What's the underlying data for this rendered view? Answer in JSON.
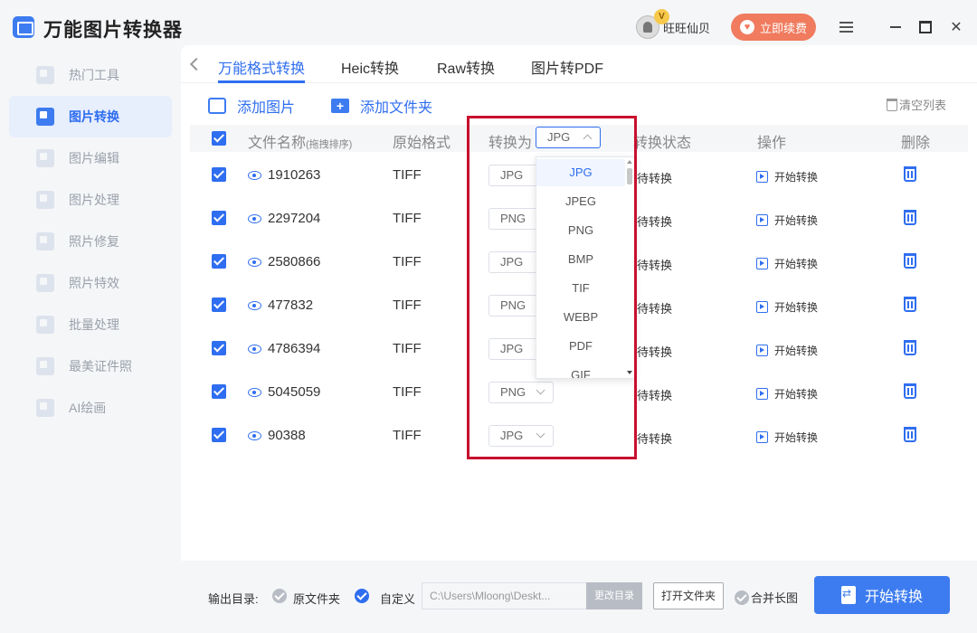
{
  "app": {
    "title": "万能图片转换器"
  },
  "user": {
    "name": "旺旺仙贝",
    "vip_badge": "V",
    "renew_label": "立即续费"
  },
  "sidebar": {
    "items": [
      {
        "label": "热门工具",
        "active": false
      },
      {
        "label": "图片转换",
        "active": true
      },
      {
        "label": "图片编辑",
        "active": false
      },
      {
        "label": "图片处理",
        "active": false
      },
      {
        "label": "照片修复",
        "active": false
      },
      {
        "label": "照片特效",
        "active": false
      },
      {
        "label": "批量处理",
        "active": false
      },
      {
        "label": "最美证件照",
        "active": false
      },
      {
        "label": "AI绘画",
        "active": false
      }
    ]
  },
  "tabs": [
    {
      "label": "万能格式转换",
      "active": true
    },
    {
      "label": "Heic转换",
      "active": false
    },
    {
      "label": "Raw转换",
      "active": false
    },
    {
      "label": "图片转PDF",
      "active": false
    }
  ],
  "toolbar": {
    "add_image": "添加图片",
    "add_folder": "添加文件夹",
    "clear_list": "清空列表"
  },
  "table": {
    "headers": {
      "filename": "文件名称",
      "filename_hint": "(拖拽排序)",
      "original_format": "原始格式",
      "convert_to": "转换为",
      "convert_to_value": "JPG",
      "status": "转换状态",
      "operation": "操作",
      "delete": "删除"
    },
    "rows": [
      {
        "name": "1910263",
        "orig": "TIFF",
        "target": "JPG",
        "status": "待转换",
        "op": "开始转换"
      },
      {
        "name": "2297204",
        "orig": "TIFF",
        "target": "PNG",
        "status": "待转换",
        "op": "开始转换"
      },
      {
        "name": "2580866",
        "orig": "TIFF",
        "target": "JPG",
        "status": "待转换",
        "op": "开始转换"
      },
      {
        "name": "477832",
        "orig": "TIFF",
        "target": "PNG",
        "status": "待转换",
        "op": "开始转换"
      },
      {
        "name": "4786394",
        "orig": "TIFF",
        "target": "JPG",
        "status": "待转换",
        "op": "开始转换"
      },
      {
        "name": "5045059",
        "orig": "TIFF",
        "target": "PNG",
        "status": "待转换",
        "op": "开始转换"
      },
      {
        "name": "90388",
        "orig": "TIFF",
        "target": "JPG",
        "status": "待转换",
        "op": "开始转换"
      }
    ]
  },
  "dropdown": {
    "options": [
      "JPG",
      "JPEG",
      "PNG",
      "BMP",
      "TIF",
      "WEBP",
      "PDF",
      "GIF"
    ],
    "selected": "JPG"
  },
  "bottom": {
    "output_label": "输出目录:",
    "original_folder": "原文件夹",
    "custom": "自定义",
    "path": "C:\\Users\\Mloong\\Deskt...",
    "change_dir": "更改目录",
    "open_folder": "打开文件夹",
    "merge_long": "合并长图",
    "start": "开始转换"
  },
  "colors": {
    "accent": "#2f6ef0",
    "highlight": "#c8102e",
    "renew": "#f07b5e"
  }
}
